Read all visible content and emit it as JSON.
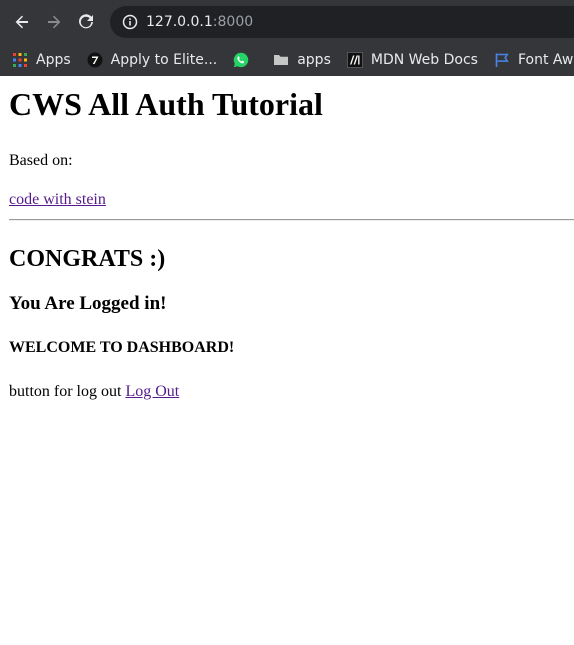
{
  "browser": {
    "url_host": "127.0.0.1",
    "url_port": ":8000",
    "bookmarks": [
      {
        "label": "Apps",
        "icon": "apps-grid-icon"
      },
      {
        "label": "Apply to Elite...",
        "icon": "seven-logo-icon"
      },
      {
        "label": "",
        "icon": "whatsapp-icon"
      },
      {
        "label": "apps",
        "icon": "folder-icon"
      },
      {
        "label": "MDN Web Docs",
        "icon": "mdn-logo-icon"
      },
      {
        "label": "Font Awe",
        "icon": "flag-icon"
      }
    ]
  },
  "page": {
    "title": "CWS All Auth Tutorial",
    "based_on": "Based on:",
    "source_link": "code with stein",
    "congrats": "CONGRATS :)",
    "logged_in": "You Are Logged in!",
    "welcome": "WELCOME TO DASHBOARD!",
    "logout_prefix": "button for log out ",
    "logout_link": "Log Out"
  }
}
